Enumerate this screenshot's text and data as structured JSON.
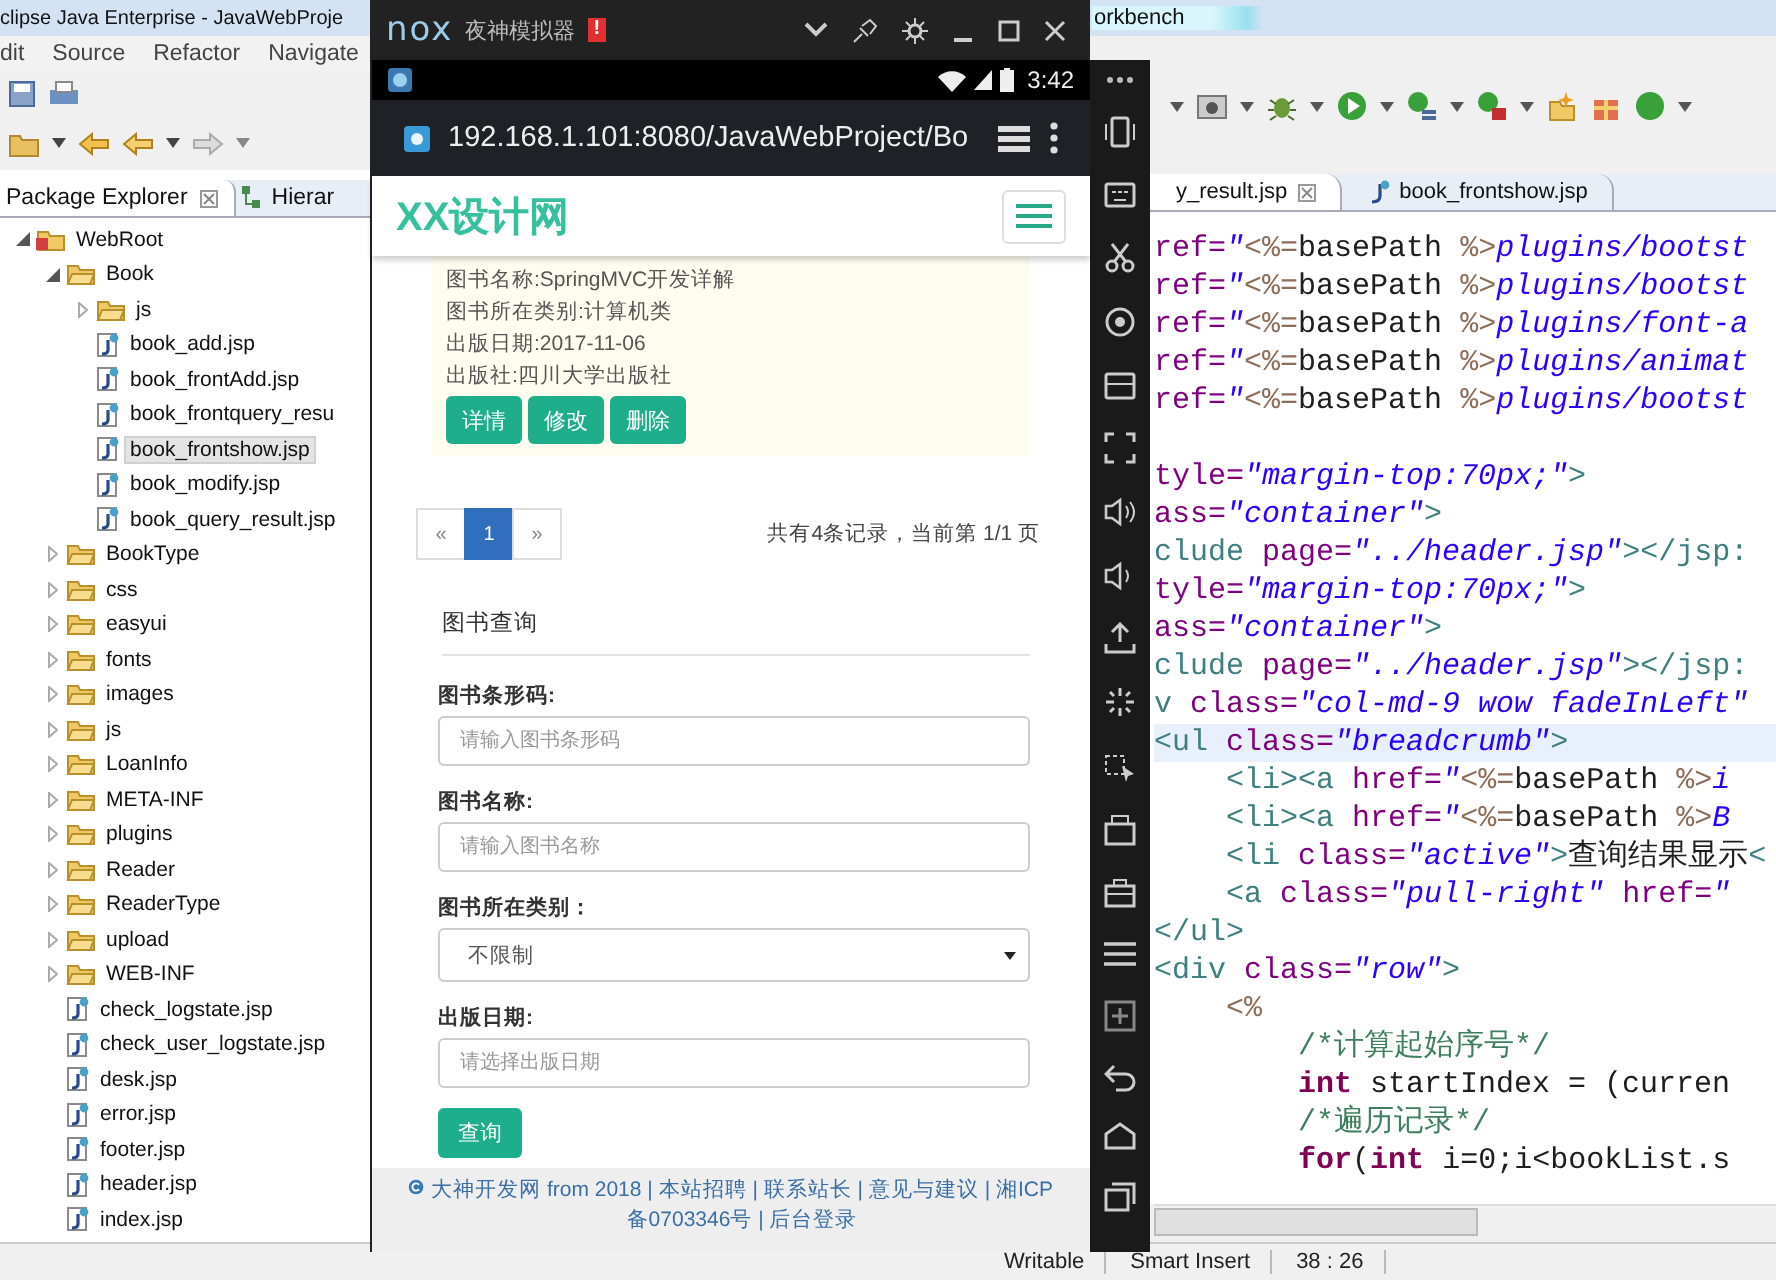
{
  "eclipse": {
    "title": "clipse Java Enterprise - JavaWebProje",
    "title_right": "orkbench",
    "menu": [
      "dit",
      "Source",
      "Refactor",
      "Navigate"
    ],
    "explorer_tabs": [
      {
        "label": "Package Explorer",
        "selected": true
      },
      {
        "label": "Hierar",
        "selected": false
      }
    ],
    "tree": [
      {
        "label": "WebRoot",
        "kind": "project",
        "expanded": true,
        "selected": false,
        "children": [
          {
            "label": "Book",
            "kind": "folder",
            "expanded": true,
            "selected": false,
            "children": [
              {
                "label": "js",
                "kind": "folder",
                "expanded": false,
                "selected": false
              },
              {
                "label": "book_add.jsp",
                "kind": "jsp",
                "selected": false
              },
              {
                "label": "book_frontAdd.jsp",
                "kind": "jsp",
                "selected": false
              },
              {
                "label": "book_frontquery_resu",
                "kind": "jsp",
                "selected": false
              },
              {
                "label": "book_frontshow.jsp",
                "kind": "jsp",
                "selected": true
              },
              {
                "label": "book_modify.jsp",
                "kind": "jsp",
                "selected": false
              },
              {
                "label": "book_query_result.jsp",
                "kind": "jsp",
                "selected": false
              }
            ]
          },
          {
            "label": "BookType",
            "kind": "folder",
            "expanded": false,
            "selected": false
          },
          {
            "label": "css",
            "kind": "folder",
            "expanded": false,
            "selected": false
          },
          {
            "label": "easyui",
            "kind": "folder",
            "expanded": false,
            "selected": false
          },
          {
            "label": "fonts",
            "kind": "folder",
            "expanded": false,
            "selected": false
          },
          {
            "label": "images",
            "kind": "folder",
            "expanded": false,
            "selected": false
          },
          {
            "label": "js",
            "kind": "folder",
            "expanded": false,
            "selected": false
          },
          {
            "label": "LoanInfo",
            "kind": "folder",
            "expanded": false,
            "selected": false
          },
          {
            "label": "META-INF",
            "kind": "folder",
            "expanded": false,
            "selected": false
          },
          {
            "label": "plugins",
            "kind": "folder",
            "expanded": false,
            "selected": false
          },
          {
            "label": "Reader",
            "kind": "folder",
            "expanded": false,
            "selected": false
          },
          {
            "label": "ReaderType",
            "kind": "folder",
            "expanded": false,
            "selected": false
          },
          {
            "label": "upload",
            "kind": "folder",
            "expanded": false,
            "selected": false
          },
          {
            "label": "WEB-INF",
            "kind": "folder",
            "expanded": false,
            "selected": false
          },
          {
            "label": "check_logstate.jsp",
            "kind": "jsp",
            "selected": false
          },
          {
            "label": "check_user_logstate.jsp",
            "kind": "jsp",
            "selected": false
          },
          {
            "label": "desk.jsp",
            "kind": "jsp",
            "selected": false
          },
          {
            "label": "error.jsp",
            "kind": "jsp",
            "selected": false
          },
          {
            "label": "footer.jsp",
            "kind": "jsp",
            "selected": false
          },
          {
            "label": "header.jsp",
            "kind": "jsp",
            "selected": false
          },
          {
            "label": "index.jsp",
            "kind": "jsp",
            "selected": false
          }
        ]
      }
    ],
    "editor_tabs": [
      {
        "label": "y_result.jsp",
        "selected": true
      },
      {
        "label": "book_frontshow.jsp",
        "selected": false
      }
    ],
    "code_lines": [
      {
        "highlighted": false,
        "segments": [
          {
            "text": "ref=",
            "kind": "attr"
          },
          {
            "text": "\"",
            "kind": "string"
          },
          {
            "text": "<%=",
            "kind": "jsp"
          },
          {
            "text": "basePath ",
            "kind": "plain"
          },
          {
            "text": "%>",
            "kind": "jsp"
          },
          {
            "text": "plugins/bootst",
            "kind": "string"
          }
        ]
      },
      {
        "highlighted": false,
        "segments": [
          {
            "text": "ref=",
            "kind": "attr"
          },
          {
            "text": "\"",
            "kind": "string"
          },
          {
            "text": "<%=",
            "kind": "jsp"
          },
          {
            "text": "basePath ",
            "kind": "plain"
          },
          {
            "text": "%>",
            "kind": "jsp"
          },
          {
            "text": "plugins/bootst",
            "kind": "string"
          }
        ]
      },
      {
        "highlighted": false,
        "segments": [
          {
            "text": "ref=",
            "kind": "attr"
          },
          {
            "text": "\"",
            "kind": "string"
          },
          {
            "text": "<%=",
            "kind": "jsp"
          },
          {
            "text": "basePath ",
            "kind": "plain"
          },
          {
            "text": "%>",
            "kind": "jsp"
          },
          {
            "text": "plugins/font-a",
            "kind": "string"
          }
        ]
      },
      {
        "highlighted": false,
        "segments": [
          {
            "text": "ref=",
            "kind": "attr"
          },
          {
            "text": "\"",
            "kind": "string"
          },
          {
            "text": "<%=",
            "kind": "jsp"
          },
          {
            "text": "basePath ",
            "kind": "plain"
          },
          {
            "text": "%>",
            "kind": "jsp"
          },
          {
            "text": "plugins/animat",
            "kind": "string"
          }
        ]
      },
      {
        "highlighted": false,
        "segments": [
          {
            "text": "ref=",
            "kind": "attr"
          },
          {
            "text": "\"",
            "kind": "string"
          },
          {
            "text": "<%=",
            "kind": "jsp"
          },
          {
            "text": "basePath ",
            "kind": "plain"
          },
          {
            "text": "%>",
            "kind": "jsp"
          },
          {
            "text": "plugins/bootst",
            "kind": "string"
          }
        ]
      },
      {
        "highlighted": false
      },
      {
        "highlighted": false,
        "segments": [
          {
            "text": "tyle=",
            "kind": "attr"
          },
          {
            "text": "\"margin-top:70px;\"",
            "kind": "string"
          },
          {
            "text": ">",
            "kind": "tag"
          }
        ]
      },
      {
        "highlighted": false,
        "segments": [
          {
            "text": "ass=",
            "kind": "attr"
          },
          {
            "text": "\"container\"",
            "kind": "string"
          },
          {
            "text": ">",
            "kind": "tag"
          }
        ]
      },
      {
        "highlighted": false,
        "segments": [
          {
            "text": "clude ",
            "kind": "tag"
          },
          {
            "text": "page=",
            "kind": "attr"
          },
          {
            "text": "\"../header.jsp\"",
            "kind": "string"
          },
          {
            "text": "></jsp:",
            "kind": "tag"
          }
        ]
      },
      {
        "highlighted": false,
        "segments": [
          {
            "text": "tyle=",
            "kind": "attr"
          },
          {
            "text": "\"margin-top:70px;\"",
            "kind": "string"
          },
          {
            "text": ">",
            "kind": "tag"
          }
        ]
      },
      {
        "highlighted": false,
        "segments": [
          {
            "text": "ass=",
            "kind": "attr"
          },
          {
            "text": "\"container\"",
            "kind": "string"
          },
          {
            "text": ">",
            "kind": "tag"
          }
        ]
      },
      {
        "highlighted": false,
        "segments": [
          {
            "text": "clude ",
            "kind": "tag"
          },
          {
            "text": "page=",
            "kind": "attr"
          },
          {
            "text": "\"../header.jsp\"",
            "kind": "string"
          },
          {
            "text": "></jsp:",
            "kind": "tag"
          }
        ]
      },
      {
        "highlighted": false,
        "segments": [
          {
            "text": "v ",
            "kind": "tag"
          },
          {
            "text": "class=",
            "kind": "attr"
          },
          {
            "text": "\"col-md-9 wow fadeInLeft\"",
            "kind": "string"
          }
        ]
      },
      {
        "highlighted": true,
        "segments": [
          {
            "text": "<ul ",
            "kind": "tag"
          },
          {
            "text": "class=",
            "kind": "attr"
          },
          {
            "text": "\"breadcrumb\"",
            "kind": "string"
          },
          {
            "text": ">",
            "kind": "tag"
          }
        ]
      },
      {
        "highlighted": false,
        "segments": [
          {
            "text": "    <li><a ",
            "kind": "tag"
          },
          {
            "text": "href=",
            "kind": "attr"
          },
          {
            "text": "\"",
            "kind": "string"
          },
          {
            "text": "<%=",
            "kind": "jsp"
          },
          {
            "text": "basePath ",
            "kind": "plain"
          },
          {
            "text": "%>",
            "kind": "jsp"
          },
          {
            "text": "i",
            "kind": "string"
          }
        ]
      },
      {
        "highlighted": false,
        "segments": [
          {
            "text": "    <li><a ",
            "kind": "tag"
          },
          {
            "text": "href=",
            "kind": "attr"
          },
          {
            "text": "\"",
            "kind": "string"
          },
          {
            "text": "<%=",
            "kind": "jsp"
          },
          {
            "text": "basePath ",
            "kind": "plain"
          },
          {
            "text": "%>",
            "kind": "jsp"
          },
          {
            "text": "B",
            "kind": "string"
          }
        ]
      },
      {
        "highlighted": false,
        "segments": [
          {
            "text": "    <li ",
            "kind": "tag"
          },
          {
            "text": "class=",
            "kind": "attr"
          },
          {
            "text": "\"active\"",
            "kind": "string"
          },
          {
            "text": ">",
            "kind": "tag"
          },
          {
            "text": "查询结果显示",
            "kind": "plain"
          },
          {
            "text": "<",
            "kind": "tag"
          }
        ]
      },
      {
        "highlighted": false,
        "segments": [
          {
            "text": "    <a ",
            "kind": "tag"
          },
          {
            "text": "class=",
            "kind": "attr"
          },
          {
            "text": "\"pull-right\"",
            "kind": "string"
          },
          {
            "text": " href=",
            "kind": "attr"
          },
          {
            "text": "\"",
            "kind": "string"
          }
        ]
      },
      {
        "highlighted": false,
        "segments": [
          {
            "text": "</ul>",
            "kind": "tag"
          }
        ]
      },
      {
        "highlighted": false,
        "segments": [
          {
            "text": "<div ",
            "kind": "tag"
          },
          {
            "text": "class=",
            "kind": "attr"
          },
          {
            "text": "\"row\"",
            "kind": "string"
          },
          {
            "text": ">",
            "kind": "tag"
          }
        ]
      },
      {
        "highlighted": false,
        "segments": [
          {
            "text": "    <%",
            "kind": "jsp"
          }
        ]
      },
      {
        "highlighted": false,
        "segments": [
          {
            "text": "        /*计算起始序号*/",
            "kind": "comment"
          }
        ]
      },
      {
        "highlighted": false,
        "segments": [
          {
            "text": "        int",
            "kind": "keyword"
          },
          {
            "text": " startIndex = (curren",
            "kind": "plain"
          }
        ]
      },
      {
        "highlighted": false,
        "segments": [
          {
            "text": "        /*遍历记录*/",
            "kind": "comment"
          }
        ]
      },
      {
        "highlighted": false,
        "segments": [
          {
            "text": "        for",
            "kind": "keyword"
          },
          {
            "text": "(",
            "kind": "plain"
          },
          {
            "text": "int",
            "kind": "keyword"
          },
          {
            "text": " i=0;i<bookList.s",
            "kind": "plain"
          }
        ]
      }
    ],
    "status_bar": [
      "Writable",
      "Smart Insert",
      "38 : 26"
    ]
  },
  "emulator": {
    "logo": "nox",
    "title": "夜神模拟器",
    "badge": "!",
    "time": "3:42",
    "url": "192.168.1.101:8080/JavaWebProject/Bo",
    "page": {
      "brand": "XX设计网",
      "book_lines": [
        "图书名称:SpringMVC开发详解",
        "图书所在类别:计算机类",
        "出版日期:2017-11-06",
        "出版社:四川大学出版社"
      ],
      "book_buttons": [
        "详情",
        "修改",
        "删除"
      ],
      "pages": [
        {
          "label": "«",
          "selected": false
        },
        {
          "label": "1",
          "selected": true
        },
        {
          "label": "»",
          "selected": false
        }
      ],
      "record_info": "共有4条记录，当前第 1/1 页",
      "search_title": "图书查询",
      "fields": [
        {
          "label": "图书条形码:",
          "kind": "input",
          "placeholder": "请输入图书条形码"
        },
        {
          "label": "图书名称:",
          "kind": "input",
          "placeholder": "请输入图书名称"
        },
        {
          "label": "图书所在类别：",
          "kind": "select",
          "value": "不限制"
        },
        {
          "label": "出版日期:",
          "kind": "input",
          "placeholder": "请选择出版日期"
        }
      ],
      "search_button": "查询",
      "footer": "大神开发网 from 2018 | 本站招聘 | 联系站长 | 意见与建议 | 湘ICP备0703346号 | 后台登录"
    }
  }
}
